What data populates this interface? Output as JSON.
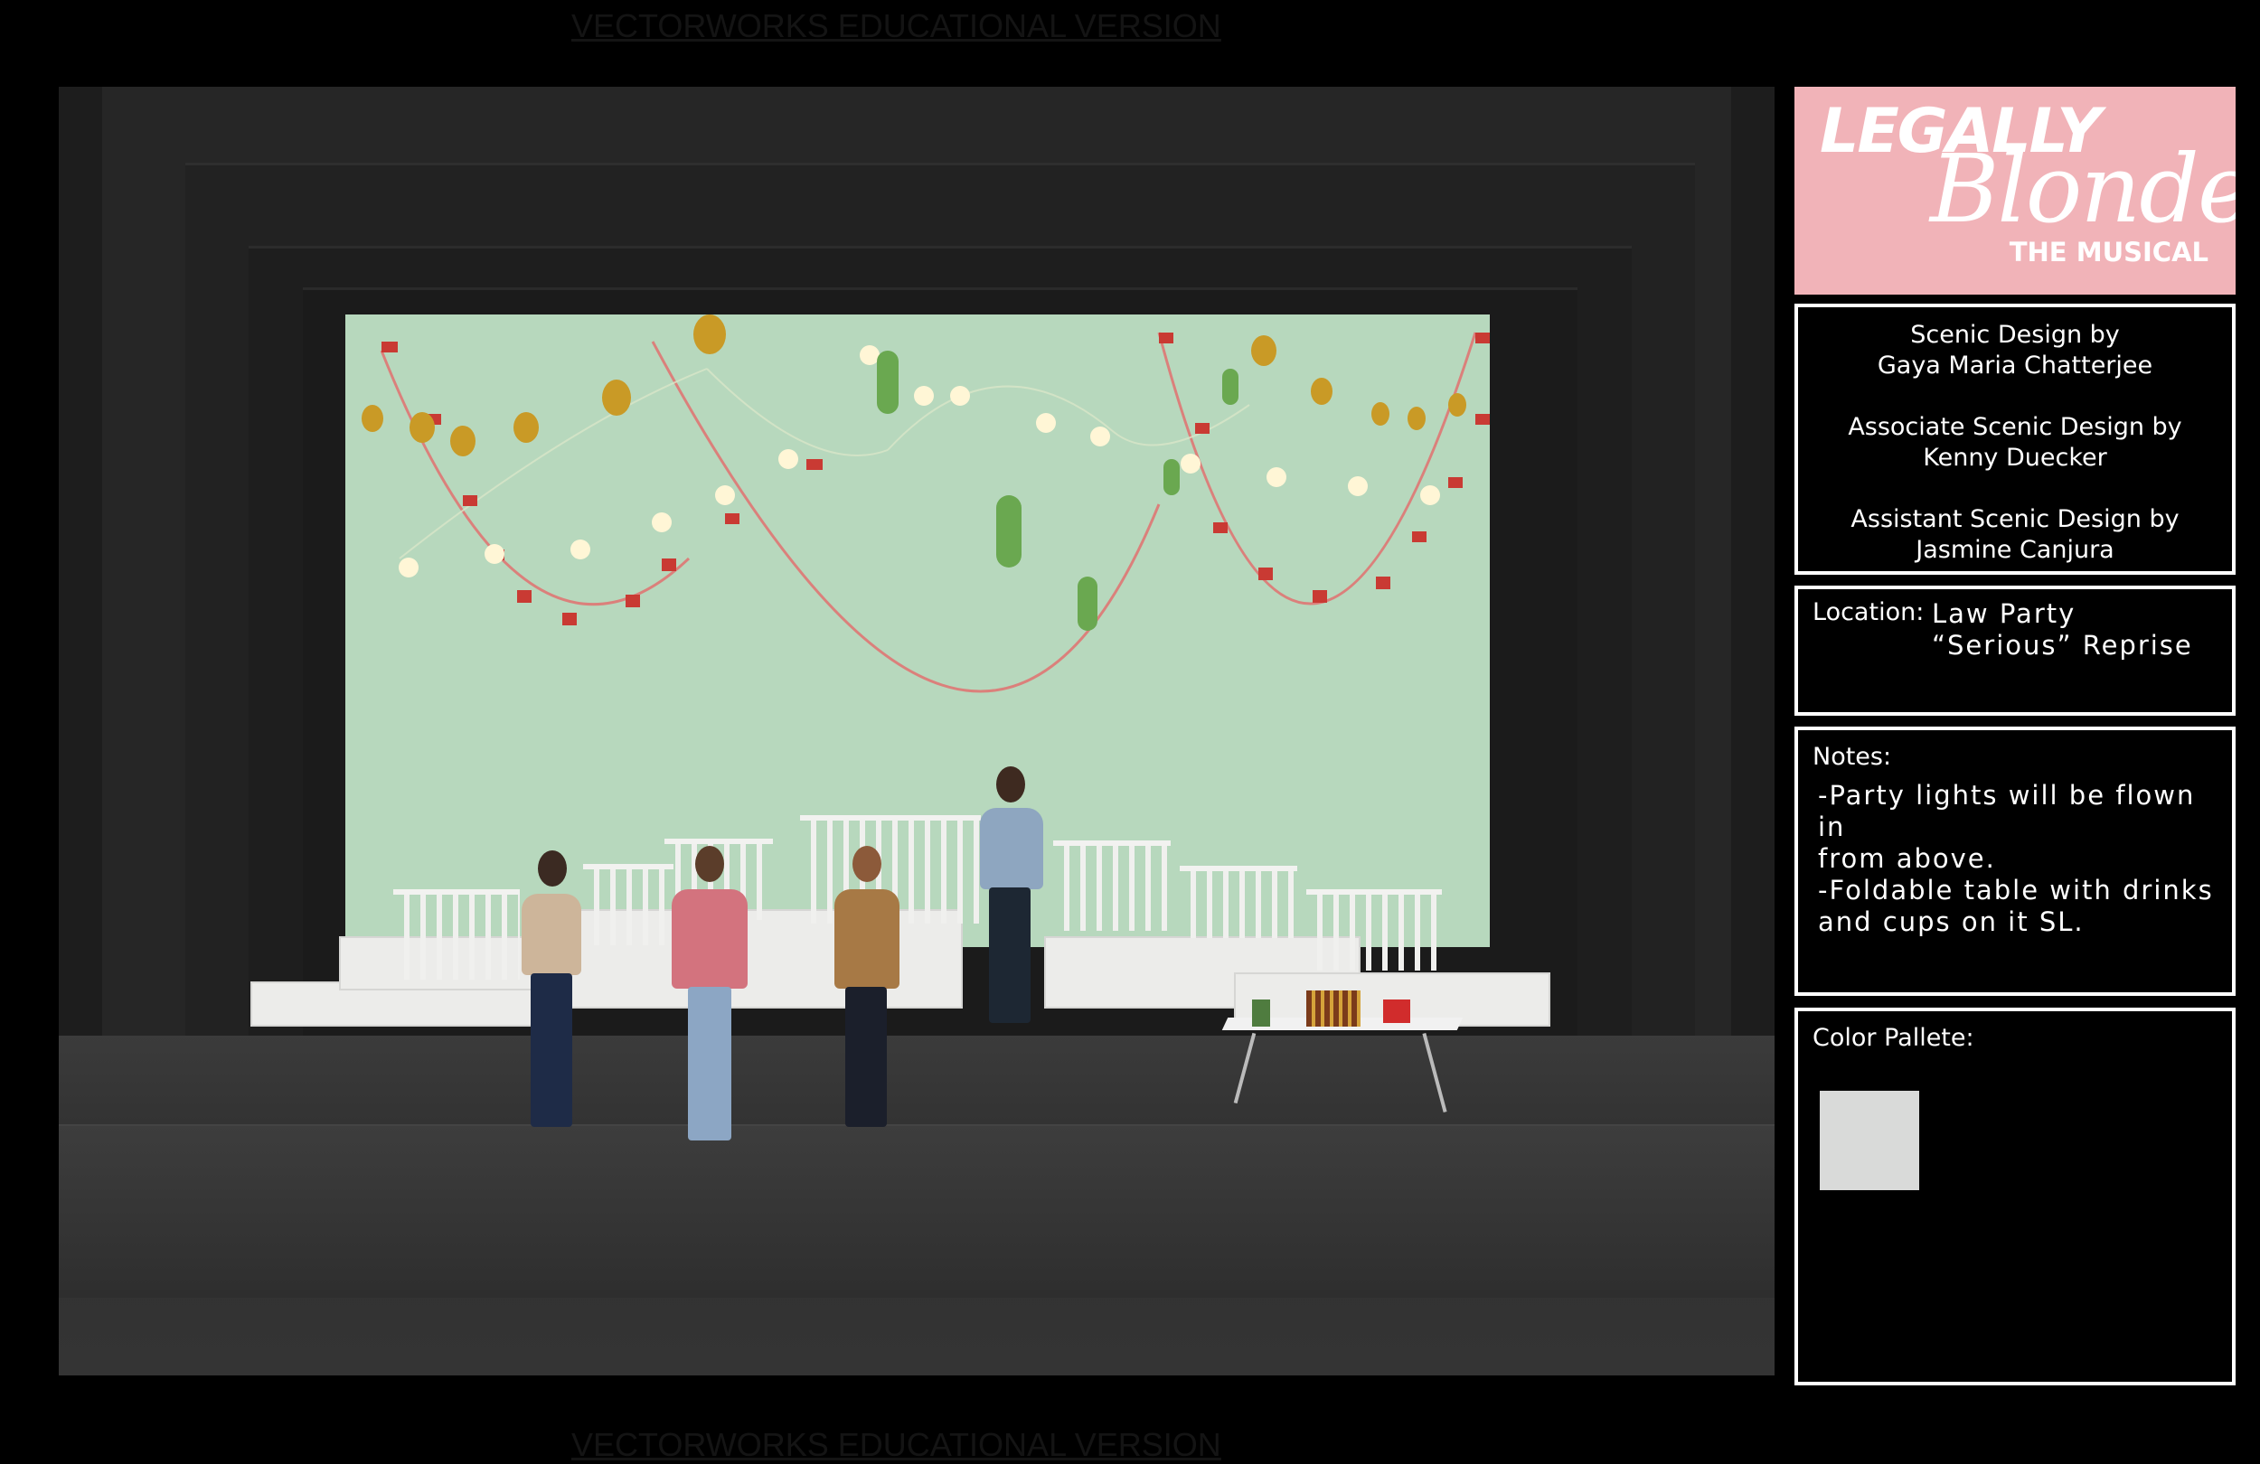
{
  "watermark": {
    "top": "VECTORWORKS EDUCATIONAL VERSION",
    "bottom": "VECTORWORKS EDUCATIONAL VERSION"
  },
  "logo": {
    "line1": "LEGALLY",
    "line2": "Blonde",
    "line3": "THE MUSICAL",
    "background": "#f1b3b8"
  },
  "credits": {
    "scenic_role": "Scenic Design by",
    "scenic_name": "Gaya Maria Chatterjee",
    "associate_role": "Associate Scenic Design by",
    "associate_name": "Kenny Duecker",
    "assistant_role": "Assistant Scenic Design by",
    "assistant_name": "Jasmine Canjura"
  },
  "location": {
    "label": "Location:",
    "line1": "Law Party",
    "line2": "“Serious” Reprise"
  },
  "notes": {
    "label": "Notes:",
    "line1": "-Party lights will be flown in",
    "line2": "from above.",
    "line3": "-Foldable table with drinks",
    "line4": "and cups on it SL."
  },
  "palette": {
    "label": "Color Pallete:",
    "swatches": [
      "#d9dad9"
    ]
  },
  "scene": {
    "backdrop_color": "#b7d8bd",
    "icons": [
      "string-lights-red-cups",
      "string-lights-stars",
      "string-lights-cactus",
      "string-lights-pineapples",
      "drinks-table",
      "actors"
    ]
  }
}
